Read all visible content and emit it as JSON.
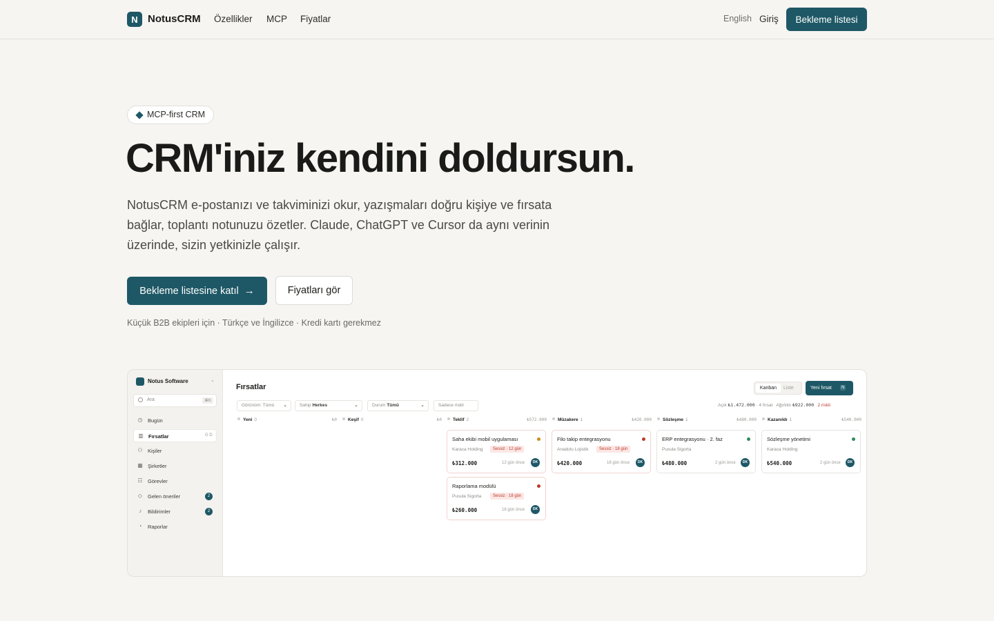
{
  "nav": {
    "brand": "NotusCRM",
    "logo_letter": "N",
    "links": [
      "Özellikler",
      "MCP",
      "Fiyatlar"
    ],
    "language": "English",
    "login": "Giriş",
    "cta": "Bekleme listesi"
  },
  "hero": {
    "pill": "MCP-first CRM",
    "headline": "CRM'iniz kendini doldursun.",
    "lead": "NotusCRM e-postanızı ve takviminizi okur, yazışmaları doğru kişiye ve fırsata bağlar, toplantı notunuzu özetler. Claude, ChatGPT ve Cursor da aynı verinin üzerinde, sizin yetkinizle çalışır.",
    "primary_cta": "Bekleme listesine katıl",
    "secondary_cta": "Fiyatları gör",
    "note": "Küçük B2B ekipleri için · Türkçe ve İngilizce · Kredi kartı gerekmez"
  },
  "app": {
    "workspace": "Notus Software",
    "search_placeholder": "Ara",
    "search_kbd": "⌘K",
    "sidebar": [
      {
        "label": "Bugün",
        "icon": "clock-icon"
      },
      {
        "label": "Fırsatlar",
        "icon": "board-icon",
        "active": true,
        "kbd": "G D"
      },
      {
        "label": "Kişiler",
        "icon": "people-icon"
      },
      {
        "label": "Şirketler",
        "icon": "building-icon"
      },
      {
        "label": "Görevler",
        "icon": "checklist-icon"
      },
      {
        "label": "Gelen öneriler",
        "icon": "diamond-icon",
        "badge": "2"
      },
      {
        "label": "Bildirimler",
        "icon": "bell-icon",
        "badge": "2"
      },
      {
        "label": "Raporlar",
        "icon": "chart-icon"
      }
    ],
    "page_title": "Fırsatlar",
    "view_kanban": "Kanban",
    "view_list": "Liste",
    "new_deal": "Yeni fırsat",
    "new_deal_kbd": "N",
    "filters": {
      "view": {
        "label": "Görünüm:",
        "value": "Tümü"
      },
      "owner": {
        "label": "Sahip",
        "value": "Herkes"
      },
      "status": {
        "label": "Durum",
        "value": "Tümü"
      },
      "risky": "Sadece riskli"
    },
    "totals": {
      "open_label": "Açık",
      "open_value": "₺1.472.000",
      "open_count": "· 4 fırsat",
      "weighted_label": "Ağırlıklı",
      "weighted_value": "₺922.000",
      "risky": "2 riskli"
    },
    "columns": [
      {
        "name": "Yeni",
        "count": "0",
        "sum": "₺0"
      },
      {
        "name": "Keşif",
        "count": "0",
        "sum": "₺0"
      },
      {
        "name": "Teklif",
        "count": "2",
        "sum": "₺572.000"
      },
      {
        "name": "Müzakere",
        "count": "1",
        "sum": "₺420.000"
      },
      {
        "name": "Sözleşme",
        "count": "1",
        "sum": "₺480.000"
      },
      {
        "name": "Kazanıldı",
        "count": "1",
        "sum": "₺540.000"
      }
    ],
    "cards": [
      {
        "title": "Saha ekibi mobil uygulaması",
        "company": "Karaca Holding",
        "tag": "Sessiz · 12 gün",
        "amount": "₺312.000",
        "ago": "12 gün önce",
        "owner": "DK",
        "dot": "#d08a1c"
      },
      {
        "title": "Raporlama modülü",
        "company": "Pusula Sigorta",
        "tag": "Sessiz · 18 gün",
        "amount": "₺260.000",
        "ago": "18 gün önce",
        "owner": "DK",
        "dot": "#c0392b"
      },
      {
        "title": "Filo takip entegrasyonu",
        "company": "Anadolu Lojistik",
        "tag": "Sessiz · 18 gün",
        "amount": "₺420.000",
        "ago": "18 gün önce",
        "owner": "DK",
        "dot": "#c0392b"
      },
      {
        "title": "ERP entegrasyonu · 2. faz",
        "company": "Pusula Sigorta",
        "tag": "",
        "amount": "₺480.000",
        "ago": "2 gün önce",
        "owner": "DK",
        "dot": "#2e8b57"
      },
      {
        "title": "Sözleşme yönetimi",
        "company": "Karaca Holding",
        "tag": "",
        "amount": "₺540.000",
        "ago": "2 gün önce",
        "owner": "DK",
        "dot": "#2e8b57"
      }
    ]
  }
}
